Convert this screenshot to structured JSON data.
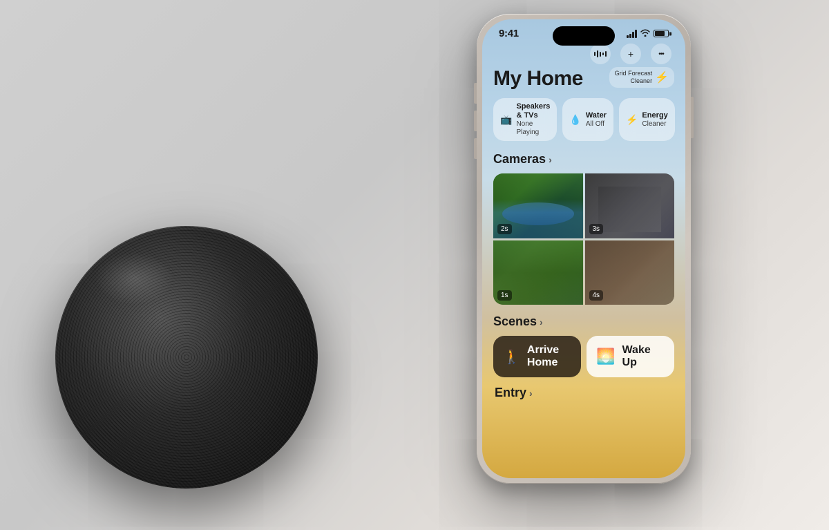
{
  "background": {
    "color": "#ddd8d0"
  },
  "statusBar": {
    "time": "9:41",
    "signal": "strong",
    "wifi": true,
    "battery": "full"
  },
  "actionBar": {
    "audioLabel": "audio-wave-icon",
    "addLabel": "+",
    "moreLabel": "•••"
  },
  "header": {
    "title": "My Home",
    "gridForecast": {
      "line1": "Grid Forecast",
      "line2": "Cleaner"
    }
  },
  "pills": [
    {
      "id": "speakers-tvs",
      "icon": "tv",
      "label": "Speakers & TVs",
      "sublabel": "None Playing"
    },
    {
      "id": "water",
      "icon": "water",
      "label": "Water",
      "sublabel": "All Off"
    },
    {
      "id": "energy",
      "icon": "energy",
      "label": "Energy",
      "sublabel": "Cleaner"
    }
  ],
  "cameras": {
    "sectionLabel": "Cameras",
    "items": [
      {
        "id": "camera-1",
        "timer": "2s",
        "type": "pool"
      },
      {
        "id": "camera-2",
        "timer": "3s",
        "type": "gym"
      },
      {
        "id": "camera-3",
        "timer": "1s",
        "type": "garden"
      },
      {
        "id": "camera-4",
        "timer": "4s",
        "type": "livingroom"
      }
    ]
  },
  "scenes": {
    "sectionLabel": "Scenes",
    "items": [
      {
        "id": "arrive-home",
        "label": "Arrive Home",
        "icon": "walk",
        "style": "dark"
      },
      {
        "id": "wake-up",
        "label": "Wake Up",
        "icon": "sun",
        "style": "light"
      }
    ]
  },
  "entry": {
    "sectionLabel": "Entry"
  }
}
